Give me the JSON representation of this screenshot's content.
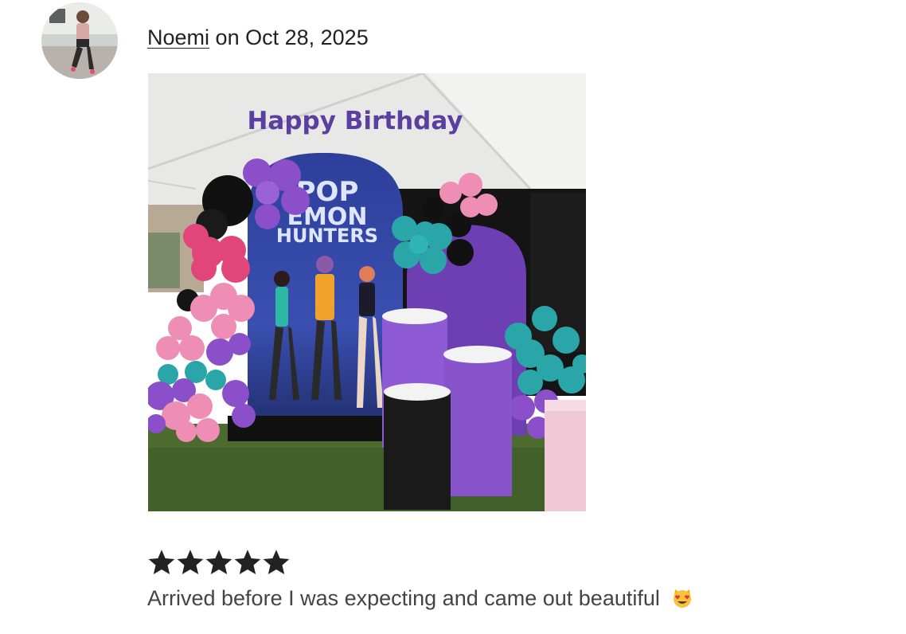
{
  "review": {
    "reviewer_name": "Noemi",
    "date_prefix": "on",
    "date": "Oct 28, 2025",
    "rating": 5,
    "rating_max": 5,
    "text": "Arrived before I was expecting and came out beautiful",
    "emoji_icon": "smiling-cat-heart-eyes-icon"
  },
  "photo": {
    "banner_text": "Happy Birthday",
    "backdrop_title_line1": "POP",
    "backdrop_title_line2": "EMON",
    "backdrop_title_line3": "HUNTERS"
  },
  "colors": {
    "star": "#222222",
    "text": "#222222",
    "muted_text": "#444444"
  }
}
